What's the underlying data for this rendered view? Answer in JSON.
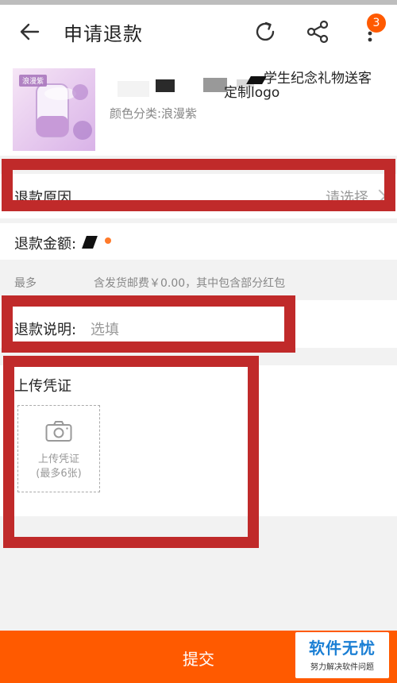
{
  "header": {
    "title": "申请退款",
    "badge_count": "3",
    "icons": [
      "back-arrow-icon",
      "refresh-icon",
      "share-icon",
      "more-vertical-icon"
    ]
  },
  "product": {
    "title_line1_visible": "学生纪念礼物送客",
    "title_line2_visible": "定制logo",
    "sku": "颜色分类:浪漫紫",
    "thumb_tag": "浪漫紫"
  },
  "refund_reason": {
    "label": "退款原因",
    "value": "请选择"
  },
  "refund_amount": {
    "label": "退款金额:"
  },
  "max_note": {
    "label": "最多",
    "detail": "含发货邮费￥0.00，其中包含部分红包"
  },
  "refund_explain": {
    "label": "退款说明:",
    "placeholder": "选填"
  },
  "upload": {
    "title": "上传凭证",
    "button_line1": "上传凭证",
    "button_line2": "(最多6张)"
  },
  "footer": {
    "submit_label": "提交"
  },
  "watermark": {
    "brand": "软件无忧",
    "slogan": "努力解决软件问题"
  },
  "colors": {
    "accent_orange": "#ff5a00",
    "annotation_red": "#c02a2a",
    "watermark_blue": "#1b7fd4"
  }
}
